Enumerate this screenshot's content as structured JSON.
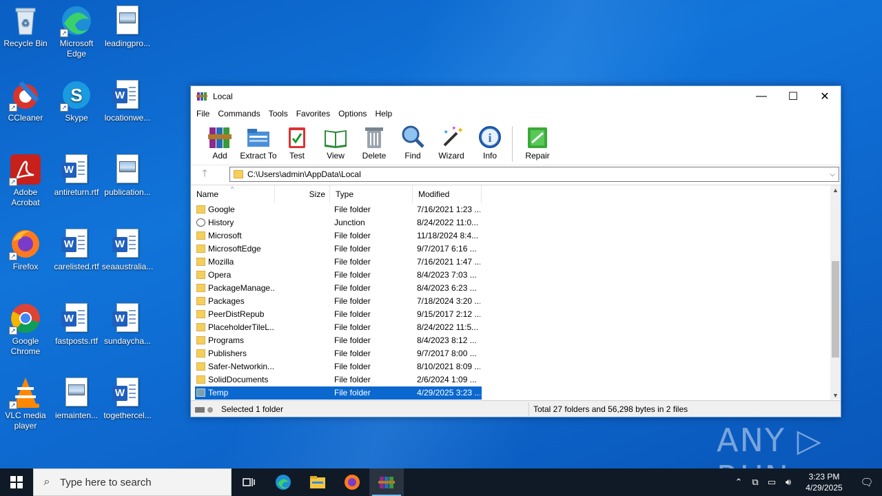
{
  "desktop": {
    "icons": [
      {
        "label": "Recycle Bin",
        "icon": "recycle-bin-icon"
      },
      {
        "label": "Microsoft Edge",
        "icon": "edge-icon"
      },
      {
        "label": "leadingpro...",
        "icon": "image-file-icon"
      },
      {
        "label": "CCleaner",
        "icon": "ccleaner-icon"
      },
      {
        "label": "Skype",
        "icon": "skype-icon"
      },
      {
        "label": "locationwe...",
        "icon": "word-doc-icon"
      },
      {
        "label": "Adobe Acrobat",
        "icon": "acrobat-icon"
      },
      {
        "label": "antireturn.rtf",
        "icon": "word-doc-icon"
      },
      {
        "label": "publication...",
        "icon": "image-file-icon"
      },
      {
        "label": "Firefox",
        "icon": "firefox-icon"
      },
      {
        "label": "carelisted.rtf",
        "icon": "word-doc-icon"
      },
      {
        "label": "seaaustralia...",
        "icon": "word-doc-icon"
      },
      {
        "label": "Google Chrome",
        "icon": "chrome-icon"
      },
      {
        "label": "fastposts.rtf",
        "icon": "word-doc-icon"
      },
      {
        "label": "sundaycha...",
        "icon": "word-doc-icon"
      },
      {
        "label": "VLC media player",
        "icon": "vlc-icon"
      },
      {
        "label": "iemainten...",
        "icon": "image-file-icon"
      },
      {
        "label": "togethercel...",
        "icon": "word-doc-icon"
      }
    ],
    "word_letter": "W",
    "shortcut_arrow": "↗"
  },
  "window": {
    "title": "Local",
    "controls": {
      "minimize": "—",
      "maximize": "☐",
      "close": "✕"
    },
    "menu": [
      "File",
      "Commands",
      "Tools",
      "Favorites",
      "Options",
      "Help"
    ],
    "toolbar": [
      {
        "label": "Add",
        "icon": "add-archive-icon"
      },
      {
        "label": "Extract To",
        "icon": "extract-folder-icon"
      },
      {
        "label": "Test",
        "icon": "test-clipboard-icon"
      },
      {
        "label": "View",
        "icon": "view-book-icon"
      },
      {
        "label": "Delete",
        "icon": "trash-icon"
      },
      {
        "label": "Find",
        "icon": "magnifier-icon"
      },
      {
        "label": "Wizard",
        "icon": "wand-icon"
      },
      {
        "label": "Info",
        "icon": "info-icon"
      },
      {
        "label": "Repair",
        "icon": "repair-icon"
      }
    ],
    "address": {
      "up": "🡑",
      "path": "C:\\Users\\admin\\AppData\\Local",
      "dropdown": "⌵"
    },
    "columns": {
      "name": "Name",
      "size": "Size",
      "type": "Type",
      "modified": "Modified",
      "sort": "^"
    },
    "rows": [
      {
        "name": "Google",
        "type": "File folder",
        "modified": "7/16/2021 1:23 ..."
      },
      {
        "name": "History",
        "type": "Junction",
        "modified": "8/24/2022 11:0..."
      },
      {
        "name": "Microsoft",
        "type": "File folder",
        "modified": "11/18/2024 8:4..."
      },
      {
        "name": "MicrosoftEdge",
        "type": "File folder",
        "modified": "9/7/2017 6:16 ..."
      },
      {
        "name": "Mozilla",
        "type": "File folder",
        "modified": "7/16/2021 1:47 ..."
      },
      {
        "name": "Opera",
        "type": "File folder",
        "modified": "8/4/2023 7:03 ..."
      },
      {
        "name": "PackageManage...",
        "type": "File folder",
        "modified": "8/4/2023 6:23 ..."
      },
      {
        "name": "Packages",
        "type": "File folder",
        "modified": "7/18/2024 3:20 ..."
      },
      {
        "name": "PeerDistRepub",
        "type": "File folder",
        "modified": "9/15/2017 2:12 ..."
      },
      {
        "name": "PlaceholderTileL...",
        "type": "File folder",
        "modified": "8/24/2022 11:5..."
      },
      {
        "name": "Programs",
        "type": "File folder",
        "modified": "8/4/2023 8:12 ..."
      },
      {
        "name": "Publishers",
        "type": "File folder",
        "modified": "9/7/2017 8:00 ..."
      },
      {
        "name": "Safer-Networkin...",
        "type": "File folder",
        "modified": "8/10/2021 8:09 ..."
      },
      {
        "name": "SolidDocuments",
        "type": "File folder",
        "modified": "2/6/2024 1:09 ..."
      },
      {
        "name": "Temp",
        "type": "File folder",
        "modified": "4/29/2025 3:23 ...",
        "selected": true
      }
    ],
    "status": {
      "left": "Selected 1 folder",
      "right": "Total 27 folders and 56,298 bytes in 2 files"
    }
  },
  "taskbar": {
    "search_placeholder": "Type here to search",
    "time": "3:23 PM",
    "date": "4/29/2025",
    "apps": [
      "task-view-icon",
      "edge-icon",
      "file-explorer-icon",
      "firefox-icon",
      "winrar-icon"
    ]
  },
  "watermark": "ANY ▷ RUN",
  "colors": {
    "selection": "#0a68cf",
    "taskbar": "#101a26",
    "desktop": "#0e6ad0"
  }
}
